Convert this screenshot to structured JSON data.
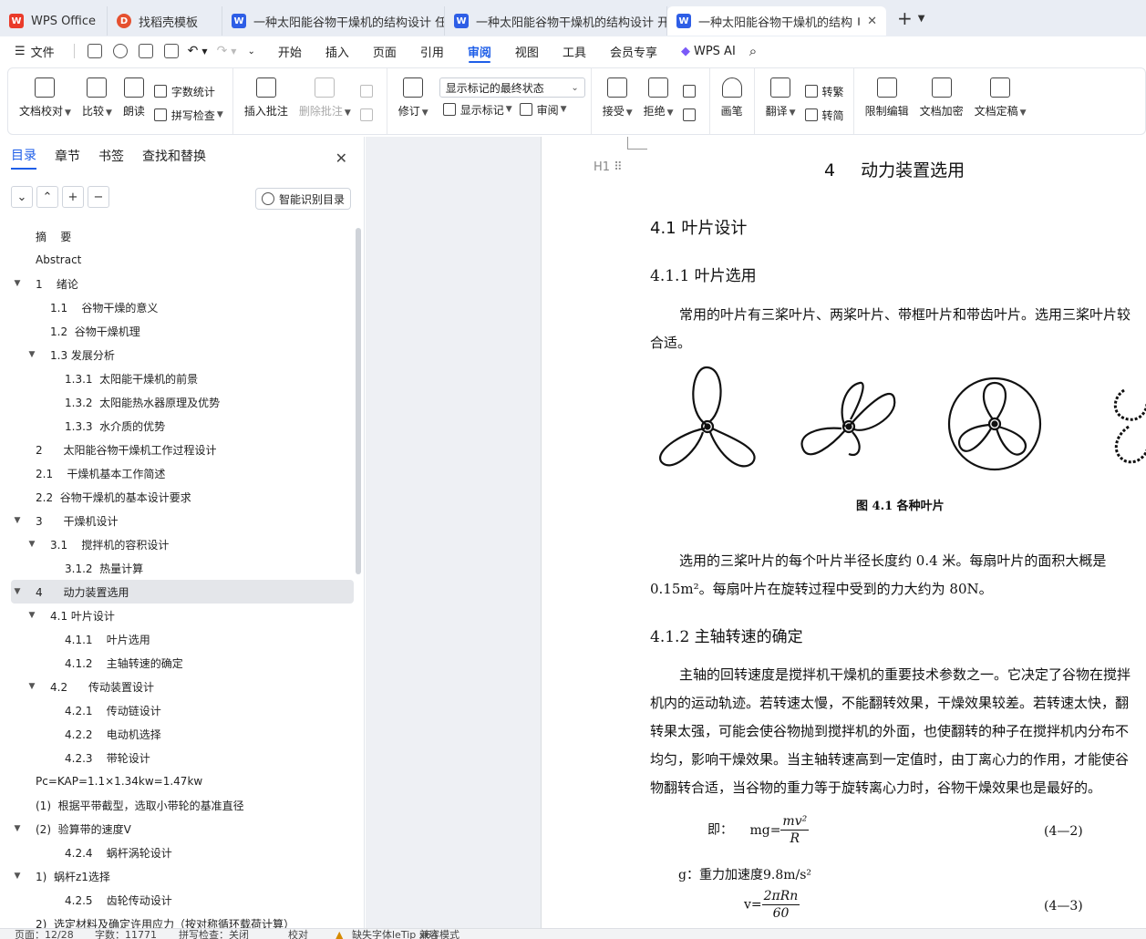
{
  "tabs": [
    {
      "label": "WPS Office",
      "icon": "wps-icon"
    },
    {
      "label": "找稻壳模板",
      "icon": "daoke-icon"
    },
    {
      "label": "一种太阳能谷物干燥机的结构设计 任",
      "icon": "word-doc-icon"
    },
    {
      "label": "一种太阳能谷物干燥机的结构设计 开",
      "icon": "word-doc-icon"
    },
    {
      "label": "一种太阳能谷物干燥机的结构",
      "icon": "word-doc-icon"
    }
  ],
  "menu": {
    "file": "文件",
    "items": [
      "开始",
      "插入",
      "页面",
      "引用",
      "审阅",
      "视图",
      "工具",
      "会员专享"
    ],
    "active": "审阅",
    "ai": "WPS AI"
  },
  "ribbon": {
    "doc_check": "文档校对",
    "compare": "比较",
    "read_aloud": "朗读",
    "word_count": "字数统计",
    "spell_check": "拼写检查",
    "insert_comment": "插入批注",
    "delete_comment": "删除批注",
    "revise": "修订",
    "markup_dropdown": "显示标记的最终状态",
    "show_markup": "显示标记",
    "review": "审阅",
    "accept": "接受",
    "reject": "拒绝",
    "pen": "画笔",
    "translate": "翻译",
    "to_traditional": "转繁",
    "to_simplified": "转简",
    "restrict_edit": "限制编辑",
    "encrypt": "文档加密",
    "finalize": "文档定稿"
  },
  "leftpane": {
    "tabs": [
      "目录",
      "章节",
      "书签",
      "查找和替换"
    ],
    "active_tab": "目录",
    "smart_btn": "智能识别目录",
    "toc": [
      {
        "text": "摘    要",
        "level": 0,
        "arrow": ""
      },
      {
        "text": "Abstract",
        "level": 0,
        "arrow": ""
      },
      {
        "text": "1    绪论",
        "level": 0,
        "arrow": "▼"
      },
      {
        "text": "1.1    谷物干燥的意义",
        "level": 1,
        "arrow": ""
      },
      {
        "text": "1.2  谷物干燥机理",
        "level": 1,
        "arrow": ""
      },
      {
        "text": "1.3 发展分析",
        "level": 1,
        "arrow": "▼"
      },
      {
        "text": "1.3.1  太阳能干燥机的前景",
        "level": 2,
        "arrow": ""
      },
      {
        "text": "1.3.2  太阳能热水器原理及优势",
        "level": 2,
        "arrow": ""
      },
      {
        "text": "1.3.3  水介质的优势",
        "level": 2,
        "arrow": ""
      },
      {
        "text": "2      太阳能谷物干燥机工作过程设计",
        "level": 0,
        "arrow": ""
      },
      {
        "text": "2.1    干燥机基本工作简述",
        "level": 0,
        "arrow": ""
      },
      {
        "text": "2.2  谷物干燥机的基本设计要求",
        "level": 0,
        "arrow": ""
      },
      {
        "text": "3      干燥机设计",
        "level": 0,
        "arrow": "▼"
      },
      {
        "text": "3.1    搅拌机的容积设计",
        "level": 1,
        "arrow": "▼"
      },
      {
        "text": "3.1.2  热量计算",
        "level": 2,
        "arrow": ""
      },
      {
        "text": "4      动力装置选用",
        "level": 0,
        "arrow": "▼",
        "selected": true
      },
      {
        "text": "4.1 叶片设计",
        "level": 1,
        "arrow": "▼"
      },
      {
        "text": "4.1.1    叶片选用",
        "level": 2,
        "arrow": ""
      },
      {
        "text": "4.1.2    主轴转速的确定",
        "level": 2,
        "arrow": ""
      },
      {
        "text": "4.2      传动装置设计",
        "level": 1,
        "arrow": "▼"
      },
      {
        "text": "4.2.1    传动链设计",
        "level": 2,
        "arrow": ""
      },
      {
        "text": "4.2.2    电动机选择",
        "level": 2,
        "arrow": ""
      },
      {
        "text": "4.2.3    带轮设计",
        "level": 2,
        "arrow": ""
      },
      {
        "text": "Pc=KAP=1.1×1.34kw=1.47kw",
        "level": 0,
        "arrow": ""
      },
      {
        "text": "(1)  根据平带截型，选取小带轮的基准直径",
        "level": 0,
        "arrow": ""
      },
      {
        "text": "(2)  验算带的速度V",
        "level": 0,
        "arrow": "▼"
      },
      {
        "text": "4.2.4    蜗杆涡轮设计",
        "level": 2,
        "arrow": ""
      },
      {
        "text": "1)  蜗杆z1选择",
        "level": 0,
        "arrow": "▼"
      },
      {
        "text": "4.2.5    齿轮传动设计",
        "level": 2,
        "arrow": ""
      },
      {
        "text": "2)  选定材料及确定许用应力（按对称循环载荷计算）",
        "level": 0,
        "arrow": ""
      }
    ]
  },
  "doc": {
    "heading_mark": "H1",
    "h1_num": "4",
    "h1_text": "动力装置选用",
    "h2": "4.1 叶片设计",
    "h3_1": "4.1.1   叶片选用",
    "p1_line1": "常用的叶片有三桨叶片、两桨叶片、带框叶片和带齿叶片。选用三桨叶片较",
    "p1_line2": "合适。",
    "caption": "图 4.1  各种叶片",
    "p2_line1": "选用的三桨叶片的每个叶片半径长度约 0.4 米。每扇叶片的面积大概是",
    "p2_line2": "0.15m²。每扇叶片在旋转过程中受到的力大约为 80N。",
    "h3_2": "4.1.2   主轴转速的确定",
    "p3_lines": [
      "主轴的回转速度是搅拌机干燥机的重要技术参数之一。它决定了谷物在搅拌",
      "机内的运动轨迹。若转速太慢，不能翻转效果，干燥效果较差。若转速太快，翻",
      "转果太强，可能会使谷物抛到搅拌机的外面，也使翻转的种子在搅拌机内分布不",
      "均匀，影响干燥效果。当主轴转速高到一定值时，由丁离心力的作用，才能使谷",
      "物翻转合适，当谷物的重力等于旋转离心力时，谷物干燥效果也是最好的。"
    ],
    "eq1_prefix": "即：",
    "eq1_lhs": "mg=",
    "eq1_num": "mv²",
    "eq1_den": "R",
    "eq1_no": "(4—2)",
    "g_line": "g：重力加速度9.8m/s²",
    "eq2_lhs": "v=",
    "eq2_num": "2πRn",
    "eq2_den": "60",
    "eq2_no": "(4—3)"
  },
  "status": {
    "page": "页面：12/28",
    "words": "字数：11771",
    "spell": "拼写检查：关闭",
    "proof": "校对",
    "missing_font": "缺失字体",
    "compat": "兼容模式",
    "extra": "leTip  x64"
  }
}
